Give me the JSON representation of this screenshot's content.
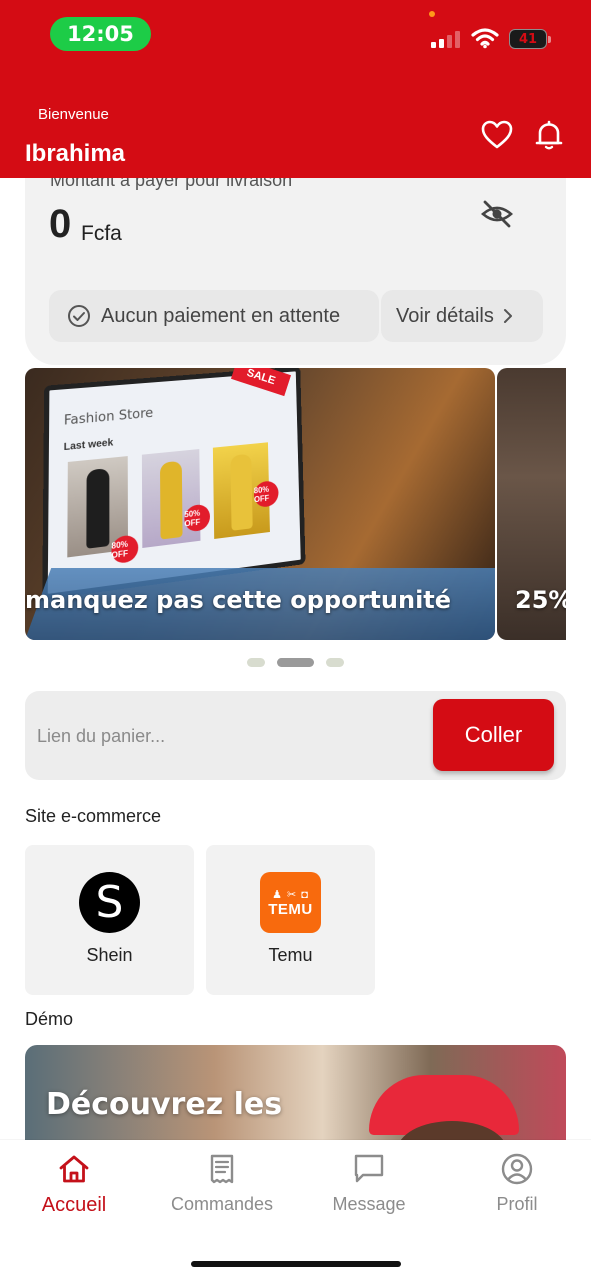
{
  "status_bar": {
    "time": "12:05",
    "battery": "41"
  },
  "header": {
    "welcome": "Bienvenue",
    "username": "Ibrahima"
  },
  "balance": {
    "label": "Montant à payer pour livraison",
    "amount": "0",
    "currency": "Fcfa",
    "pending_text": "Aucun paiement en attente",
    "details_label": "Voir détails"
  },
  "banners": [
    {
      "caption": "manquez pas cette opportunité",
      "store_title": "Fashion Store",
      "week_label": "Last week",
      "sale_text": "SALE",
      "discounts": [
        "80% OFF",
        "50% OFF",
        "80% OFF"
      ]
    },
    {
      "caption": "25%"
    }
  ],
  "carousel": {
    "count": 3,
    "active_index": 1
  },
  "paste": {
    "placeholder": "Lien du panier...",
    "button_label": "Coller"
  },
  "ecommerce": {
    "title": "Site e-commerce",
    "sites": [
      {
        "name": "Shein",
        "logo_letter": "S"
      },
      {
        "name": "Temu",
        "logo_word": "TEMU"
      }
    ]
  },
  "demo": {
    "title": "Démo",
    "banner_text": "Découvrez les"
  },
  "nav": {
    "items": [
      {
        "label": "Accueil",
        "icon": "home-icon",
        "active": true
      },
      {
        "label": "Commandes",
        "icon": "receipt-icon",
        "active": false
      },
      {
        "label": "Message",
        "icon": "chat-icon",
        "active": false
      },
      {
        "label": "Profil",
        "icon": "user-icon",
        "active": false
      }
    ]
  },
  "colors": {
    "brand": "#d40c14",
    "status_pill": "#1dcc47",
    "temu": "#f86a0d"
  }
}
